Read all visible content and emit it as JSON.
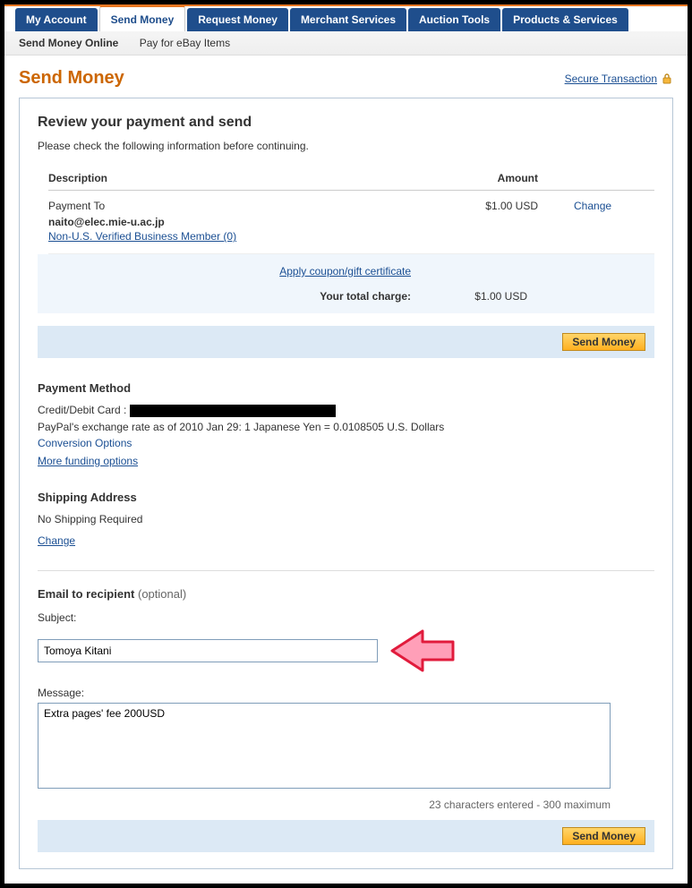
{
  "tabs": {
    "my_account": "My Account",
    "send_money": "Send Money",
    "request_money": "Request Money",
    "merchant_services": "Merchant Services",
    "auction_tools": "Auction Tools",
    "products_services": "Products & Services"
  },
  "subtabs": {
    "online": "Send Money Online",
    "ebay": "Pay for eBay Items"
  },
  "page": {
    "title": "Send Money",
    "secure": "Secure Transaction"
  },
  "review": {
    "heading": "Review your payment and send",
    "note": "Please check the following information before continuing.",
    "col_description": "Description",
    "col_amount": "Amount",
    "payment_to_label": "Payment To",
    "payment_to_email": "naito@elec.mie-u.ac.jp",
    "member_link": "Non-U.S. Verified Business Member (0)",
    "amount": "$1.00 USD",
    "change": "Change",
    "coupon": "Apply coupon/gift certificate",
    "total_label": "Your total charge:",
    "total_amount": "$1.00 USD",
    "send_button": "Send Money"
  },
  "payment_method": {
    "heading": "Payment Method",
    "card_label": "Credit/Debit Card :",
    "exchange": "PayPal's exchange rate as of 2010 Jan 29: 1 Japanese Yen = 0.0108505 U.S. Dollars",
    "conversion": "Conversion Options",
    "more_funding": "More funding options"
  },
  "shipping": {
    "heading": "Shipping Address",
    "text": "No Shipping Required",
    "change": "Change"
  },
  "email": {
    "heading_bold": "Email to recipient",
    "heading_opt": " (optional)",
    "subject_label": "Subject:",
    "subject_value": "Tomoya Kitani",
    "message_label": "Message:",
    "message_value": "Extra pages' fee 200USD",
    "char_count": "23 characters entered - 300 maximum"
  }
}
